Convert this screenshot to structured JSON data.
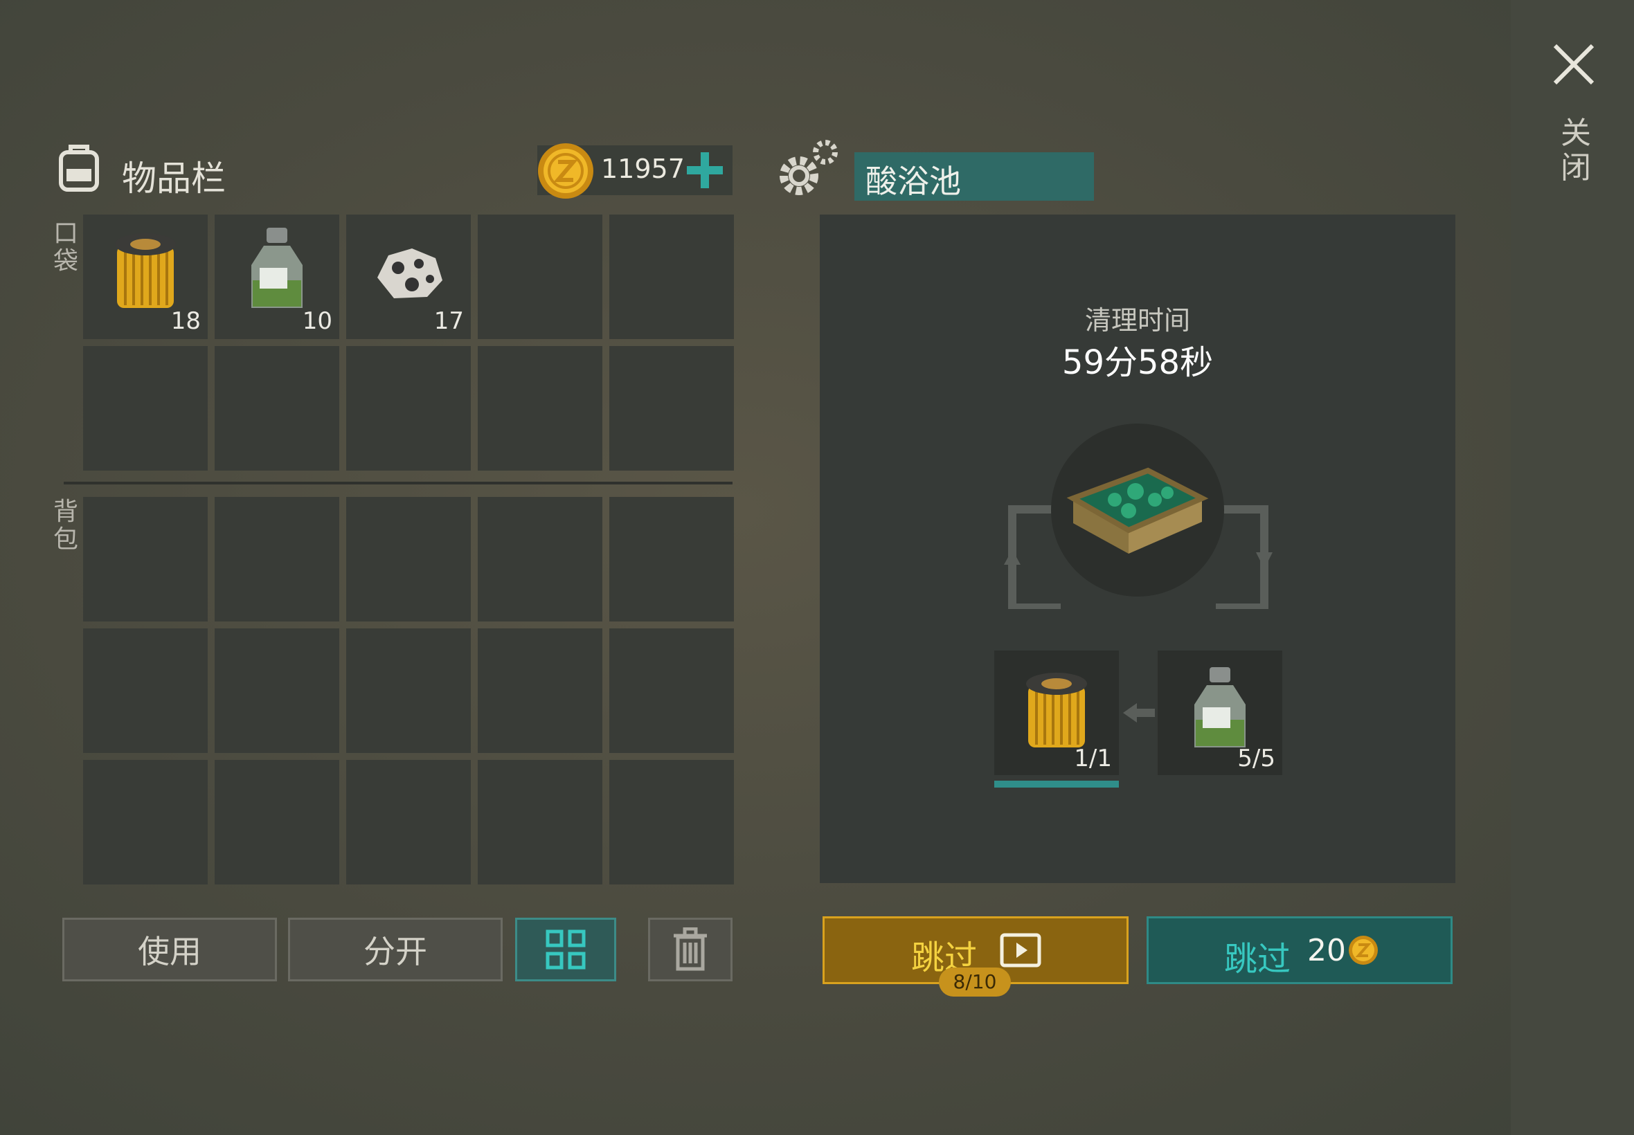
{
  "window": {
    "close_label": "关闭"
  },
  "inventory": {
    "title": "物品栏",
    "coins": "11957",
    "pocket_label": "口袋",
    "backpack_label": "背包",
    "pocket_items": [
      {
        "icon": "filter-cartridge-icon",
        "count": "18"
      },
      {
        "icon": "acid-bottle-icon",
        "count": "10"
      },
      {
        "icon": "ore-rock-icon",
        "count": "17"
      }
    ],
    "buttons": {
      "use": "使用",
      "split": "分开"
    }
  },
  "station": {
    "name": "酸浴池",
    "timer_label": "清理时间",
    "timer_value": "59分58秒",
    "inputs": [
      {
        "icon": "filter-cartridge-icon",
        "count": "1/1"
      },
      {
        "icon": "acid-bottle-icon",
        "count": "5/5"
      }
    ],
    "output_icon": "ore-crate-icon",
    "skip_ad": {
      "label": "跳过",
      "uses": "8/10"
    },
    "skip_gold": {
      "label": "跳过",
      "cost": "20"
    }
  },
  "colors": {
    "accent_teal": "#2f8e8a",
    "gold": "#d9a21e"
  }
}
